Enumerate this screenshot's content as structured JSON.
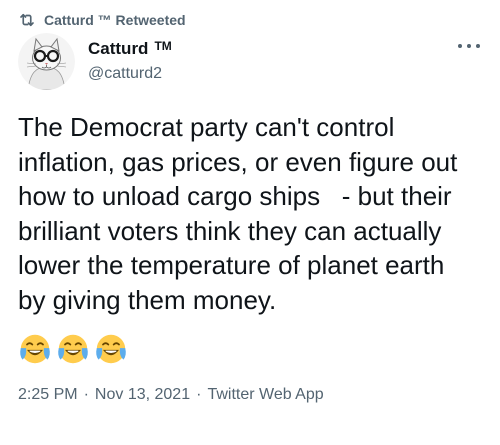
{
  "retweet_banner": {
    "text": "Catturd ™ Retweeted",
    "icon": "retweet-icon"
  },
  "author": {
    "display_name": "Catturd",
    "tm": "TM",
    "handle": "@catturd2",
    "avatar_icon": "avatar-cat-glasses"
  },
  "more_icon": "more-options-icon",
  "tweet": {
    "text": "The Democrat party can't control\ninflation, gas prices, or even figure out\nhow to unload cargo ships   - but their\nbrilliant voters think they can actually\nlower the temperature of planet earth\nby giving them money.",
    "emojis": [
      "face-with-tears-of-joy-icon",
      "face-with-tears-of-joy-icon",
      "face-with-tears-of-joy-icon"
    ]
  },
  "meta": {
    "time": "2:25 PM",
    "sep1": "·",
    "date": "Nov 13, 2021",
    "sep2": "·",
    "source": "Twitter Web App"
  },
  "colors": {
    "text_primary": "#0f1419",
    "text_secondary": "#536471",
    "emoji_face": "#FFCC4D",
    "emoji_tears": "#5DADEC"
  }
}
